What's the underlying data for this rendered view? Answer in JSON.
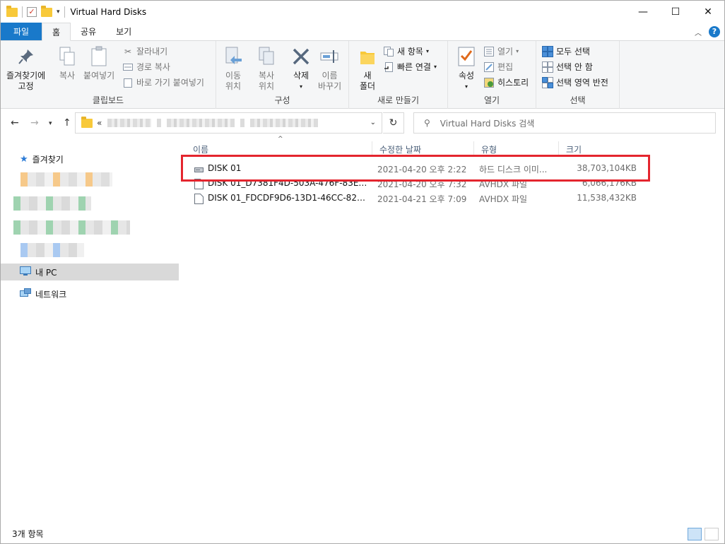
{
  "window": {
    "title": "Virtual Hard Disks",
    "controls": {
      "minimize": "—",
      "maximize": "☐",
      "close": "✕"
    }
  },
  "tabs": [
    {
      "label": "파일"
    },
    {
      "label": "홈"
    },
    {
      "label": "공유"
    },
    {
      "label": "보기"
    }
  ],
  "ribbon": {
    "clipboard": {
      "label": "클립보드",
      "pin_line1": "즐겨찾기에",
      "pin_line2": "고정",
      "copy": "복사",
      "paste": "붙여넣기",
      "cut": "잘라내기",
      "copy_path": "경로 복사",
      "paste_shortcut": "바로 가기 붙여넣기"
    },
    "organize": {
      "label": "구성",
      "move_line1": "이동",
      "move_line2": "위치",
      "copy_line1": "복사",
      "copy_line2": "위치",
      "delete": "삭제",
      "rename_line1": "이름",
      "rename_line2": "바꾸기"
    },
    "new": {
      "label": "새로 만들기",
      "new_folder_line1": "새",
      "new_folder_line2": "폴더",
      "new_item": "새 항목",
      "easy_access": "빠른 연결"
    },
    "open": {
      "label": "열기",
      "properties": "속성",
      "open": "열기",
      "edit": "편집",
      "history": "히스토리"
    },
    "select": {
      "label": "선택",
      "select_all": "모두 선택",
      "select_none": "선택 안 함",
      "invert": "선택 영역 반전"
    }
  },
  "address": {
    "prefix": "«"
  },
  "search": {
    "placeholder": "Virtual Hard Disks 검색"
  },
  "sidebar": {
    "quick_access": "즐겨찾기",
    "this_pc": "내 PC",
    "network": "네트워크"
  },
  "columns": {
    "name": "이름",
    "date": "수정한 날짜",
    "type": "유형",
    "size": "크기"
  },
  "files": [
    {
      "name": "DISK 01",
      "date": "2021-04-20 오후 2:22",
      "type": "하드 디스크 이미...",
      "size": "38,703,104KB"
    },
    {
      "name": "DISK 01_D7381F4D-503A-476F-83ED-...",
      "date": "2021-04-20 오후 7:32",
      "type": "AVHDX 파일",
      "size": "6,066,176KB"
    },
    {
      "name": "DISK 01_FDCDF9D6-13D1-46CC-827E-...",
      "date": "2021-04-21 오후 7:09",
      "type": "AVHDX 파일",
      "size": "11,538,432KB"
    }
  ],
  "status": {
    "item_count": "3개 항목"
  },
  "colors": {
    "accent": "#1979ca",
    "highlight_box": "#e4252e",
    "selected_nav": "#d9d9d9"
  }
}
